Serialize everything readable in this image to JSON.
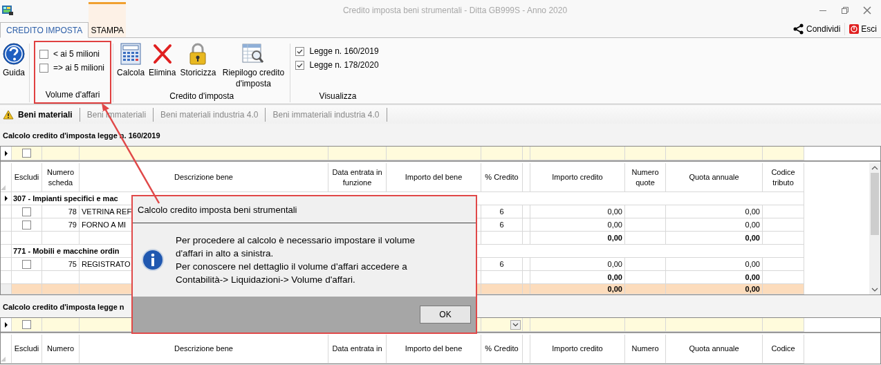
{
  "window": {
    "title": "Credito imposta beni strumentali -  Ditta GB999S - Anno 2020"
  },
  "ribbon_tabs": [
    {
      "label": "CREDITO IMPOSTA",
      "selected": true,
      "kind": "normal"
    },
    {
      "label": "STAMPA",
      "selected": false,
      "kind": "contextual"
    }
  ],
  "share": "Condividi",
  "exit": "Esci",
  "ribbon_groups": [
    {
      "annotated": false,
      "items": [
        {
          "kind": "large",
          "label": "Guida"
        }
      ]
    },
    {
      "label": "Volume d'affari",
      "annotated": true,
      "items": [
        {
          "kind": "check",
          "label": "< ai 5 milioni",
          "checked": false
        },
        {
          "kind": "check",
          "label": "=> ai 5 milioni",
          "checked": false
        }
      ]
    },
    {
      "label": "Credito d'imposta",
      "annotated": false,
      "items": [
        {
          "kind": "large",
          "label": "Calcola"
        },
        {
          "kind": "large",
          "label": "Elimina"
        },
        {
          "kind": "large",
          "label": "Storicizza"
        },
        {
          "kind": "large",
          "label": "Riepilogo credito d'imposta"
        }
      ]
    },
    {
      "label": "Visualizza",
      "annotated": false,
      "items": [
        {
          "kind": "check",
          "label": "Legge n. 160/2019",
          "checked": true
        },
        {
          "kind": "check",
          "label": "Legge n. 178/2020",
          "checked": true
        }
      ]
    }
  ],
  "sheet_tabs": [
    {
      "label": "Beni materiali",
      "selected": true,
      "warning": true
    },
    {
      "label": "Beni immateriali",
      "selected": false,
      "warning": false
    },
    {
      "label": "Beni materiali industria 4.0",
      "selected": false,
      "warning": false
    },
    {
      "label": "Beni immateriali industria 4.0",
      "selected": false,
      "warning": false
    }
  ],
  "grids": [
    {
      "title": "Calcolo credito d'imposta legge n. 160/2019",
      "filter": {
        "escludi_checked": false,
        "dropdown": false
      },
      "columns": [
        "Escludi",
        "Numero scheda",
        "Descrizione bene",
        "Data entrata in funzione",
        "Importo del bene",
        "% Credito",
        "Importo credito",
        "Numero quote",
        "Quota annuale",
        "Codice tributo"
      ],
      "scrollbar": true,
      "rows": [
        {
          "kind": "group",
          "current": true,
          "label": "307 - Impianti specifici e mac"
        },
        {
          "kind": "item",
          "current": false,
          "escludi": false,
          "numero": "78",
          "descrizione": "VETRINA REF",
          "credito": "6",
          "importo_credito": "0,00",
          "quota": "0,00"
        },
        {
          "kind": "item",
          "current": false,
          "escludi": false,
          "numero": "79",
          "descrizione": "FORNO A MI",
          "credito": "6",
          "importo_credito": "0,00",
          "quota": "0,00"
        },
        {
          "kind": "subtotal",
          "current": false,
          "importo_credito": "0,00",
          "quota": "0,00"
        },
        {
          "kind": "group",
          "current": false,
          "label": "771 - Mobili e macchine ordin"
        },
        {
          "kind": "item",
          "current": false,
          "escludi": false,
          "numero": "75",
          "descrizione": "REGISTRATO",
          "credito": "6",
          "importo_credito": "0,00",
          "quota": "0,00"
        },
        {
          "kind": "subtotal",
          "current": false,
          "importo_credito": "0,00",
          "quota": "0,00"
        },
        {
          "kind": "total",
          "current": false,
          "importo_credito": "0,00",
          "quota": "0,00"
        }
      ]
    },
    {
      "title": "Calcolo credito d'imposta legge n",
      "filter": {
        "escludi_checked": false,
        "dropdown": true
      },
      "columns": [
        "Escludi",
        "Numero",
        "Descrizione bene",
        "Data entrata in",
        "Importo del bene",
        "% Credito",
        "Importo credito",
        "Numero",
        "Quota annuale",
        "Codice"
      ],
      "scrollbar": false
    }
  ],
  "dialog": {
    "title": "Calcolo credito imposta beni strumentali",
    "annotated": true,
    "message": "Per procedere al calcolo è necessario impostare il volume\nd'affari in alto a sinistra.\nPer conoscere nel dettaglio il volume d'affari accedere a\nContabilità-> Liquidazioni-> Volume d'affari.",
    "button": "OK"
  },
  "callout_arrow": true
}
